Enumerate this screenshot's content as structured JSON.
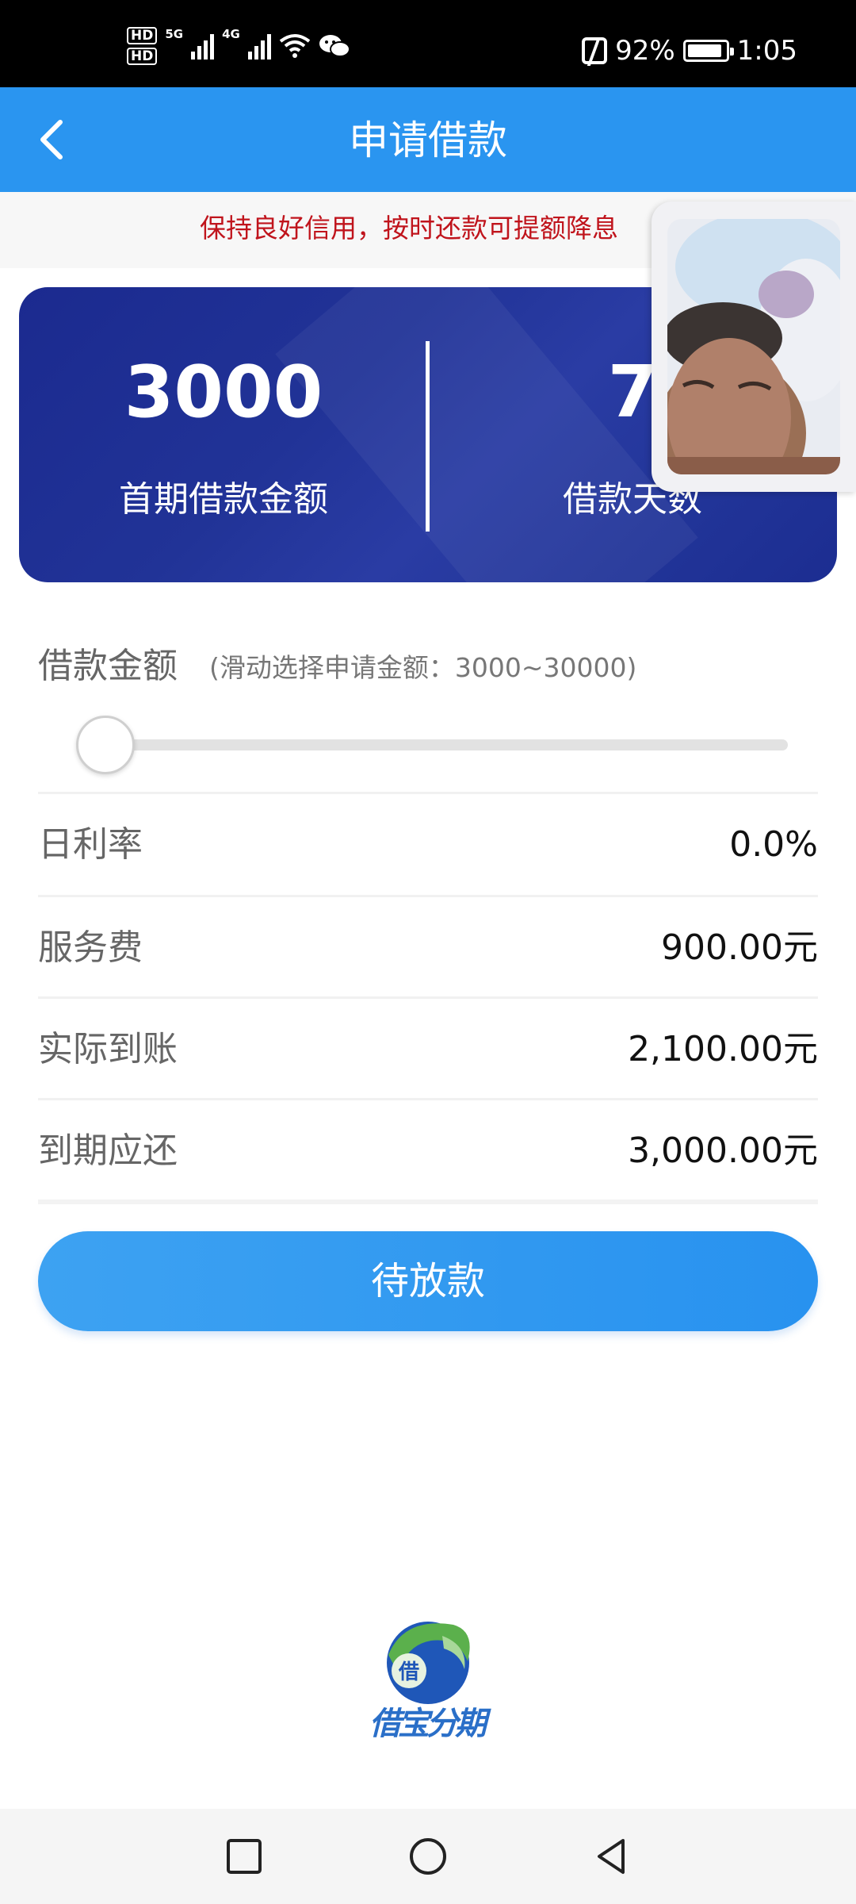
{
  "status_bar": {
    "hd1": "HD",
    "hd2": "HD",
    "net1": "5G",
    "net2": "4G",
    "battery_percent": "92%",
    "time": "1:05",
    "icons": [
      "signal-icon",
      "wifi-icon",
      "wechat-icon",
      "nfc-icon",
      "battery-icon"
    ]
  },
  "header": {
    "title": "申请借款",
    "back_icon": "chevron-left-icon"
  },
  "notice": {
    "text": "保持良好信用，按时还款可提额降息"
  },
  "card": {
    "amount_value": "3000",
    "amount_label": "首期借款金额",
    "days_value": "7",
    "days_label": "借款天数"
  },
  "slider": {
    "title": "借款金额",
    "hint": "(滑动选择申请金额：3000~30000)",
    "min": 3000,
    "max": 30000,
    "value": 3000
  },
  "rows": [
    {
      "label": "日利率",
      "value": "0.0%"
    },
    {
      "label": "服务费",
      "value": "900.00元"
    },
    {
      "label": "实际到账",
      "value": "2,100.00元"
    },
    {
      "label": "到期应还",
      "value": "3,000.00元"
    }
  ],
  "button": {
    "label": "待放款"
  },
  "logo": {
    "badge_char": "借",
    "brand_text": "借宝分期"
  },
  "colors": {
    "header": "#2a95f0",
    "notice_text": "#c0141c",
    "card": "#213397",
    "button": "#2a95f0"
  },
  "nav": [
    "recent-apps-icon",
    "home-icon",
    "back-icon"
  ]
}
